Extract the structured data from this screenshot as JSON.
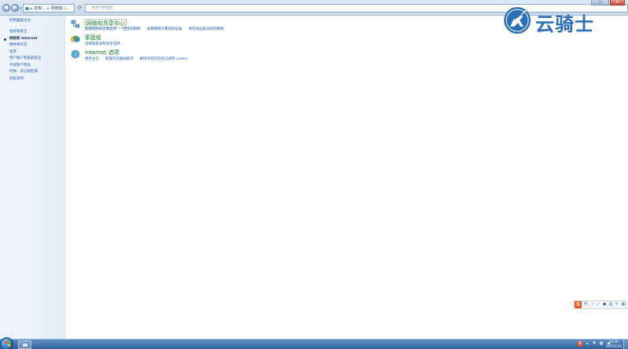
{
  "address_bar": {
    "breadcrumbs": [
      "控制...",
      "网络和 I..."
    ],
    "search_placeholder": "搜索控制面板"
  },
  "sidebar": {
    "home": "控制面板主页",
    "items": [
      {
        "label": "系统和安全",
        "active": false
      },
      {
        "label": "网络和 Internet",
        "active": true
      },
      {
        "label": "硬件和声音",
        "active": false
      },
      {
        "label": "程序",
        "active": false
      },
      {
        "label": "用户帐户和家庭安全",
        "active": false
      },
      {
        "label": "外观和个性化",
        "active": false
      },
      {
        "label": "时钟、语言和区域",
        "active": false
      },
      {
        "label": "轻松访问",
        "active": false
      }
    ]
  },
  "categories": [
    {
      "title": "网络和共享中心",
      "icon": "network-icon",
      "links": [
        "查看网络状态和任务",
        "连接到网络",
        "查看网络计算机和设备",
        "将无线设备添加到网络"
      ]
    },
    {
      "title": "家庭组",
      "icon": "homegroup-icon",
      "links": [
        "选择家庭组和共享选项"
      ]
    },
    {
      "title": "Internet 选项",
      "icon": "internet-globe-icon",
      "links": [
        "更改主页",
        "管理浏览器加载项",
        "删除浏览的历史记录和 cookie"
      ]
    }
  ],
  "watermark": {
    "text": "云骑士",
    "color": "#2a6fb8"
  },
  "ime_toolbar": {
    "brand": "S",
    "items": [
      "中",
      "☽",
      "♪",
      "●",
      "▤",
      "✎",
      "▦"
    ]
  },
  "taskbar": {
    "tray": {
      "ime_label": "S",
      "clock_time": "14:36",
      "clock_date": "2019/1/26"
    }
  },
  "colors": {
    "link": "#1c5db1",
    "category_title": "#0f7d23",
    "taskbar": "#2f5f98"
  }
}
